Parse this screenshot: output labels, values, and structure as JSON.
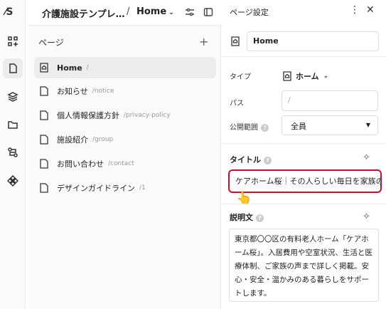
{
  "rail": {
    "logo": "⁄S",
    "items": [
      "add-block",
      "pages",
      "layers",
      "folder",
      "flow",
      "components"
    ]
  },
  "header": {
    "site_title": "介護施設テンプレ…",
    "separator": "/",
    "current_page": "Home"
  },
  "pages_panel": {
    "heading": "ページ",
    "add": "+",
    "items": [
      {
        "label": "Home",
        "path": "/",
        "icon": "home-page-icon",
        "active": true
      },
      {
        "label": "お知らせ",
        "path": "/notice",
        "icon": "page-icon"
      },
      {
        "label": "個人情報保護方針",
        "path": "/privacy-policy",
        "icon": "page-icon"
      },
      {
        "label": "施設紹介",
        "path": "/group",
        "icon": "page-icon"
      },
      {
        "label": "お問い合わせ",
        "path": "/contact",
        "icon": "page-icon"
      },
      {
        "label": "デザインガイドライン",
        "path": "/1",
        "icon": "page-icon"
      }
    ]
  },
  "settings": {
    "title": "ページ設定",
    "more": "⋮",
    "close": "✕",
    "name_value": "Home",
    "type_label": "タイプ",
    "type_value": "ホーム",
    "path_label": "パス",
    "path_placeholder": "/",
    "scope_label": "公開範囲",
    "scope_value": "全員",
    "title_label": "タイトル",
    "title_value": "ケアホーム桜｜その人らしい毎日を家族の",
    "desc_label": "説明文",
    "desc_value": "東京都〇〇区の有料老人ホーム「ケアホーム桜」。入居費用や空室状況、生活と医療体制、ご家族の声まで詳しく掲載。安心・安全・温かみのある暮らしをサポートします。",
    "help": "?",
    "sparkle": "✧"
  },
  "colors": {
    "highlight": "#c8102e",
    "active_bg": "#ececec"
  }
}
